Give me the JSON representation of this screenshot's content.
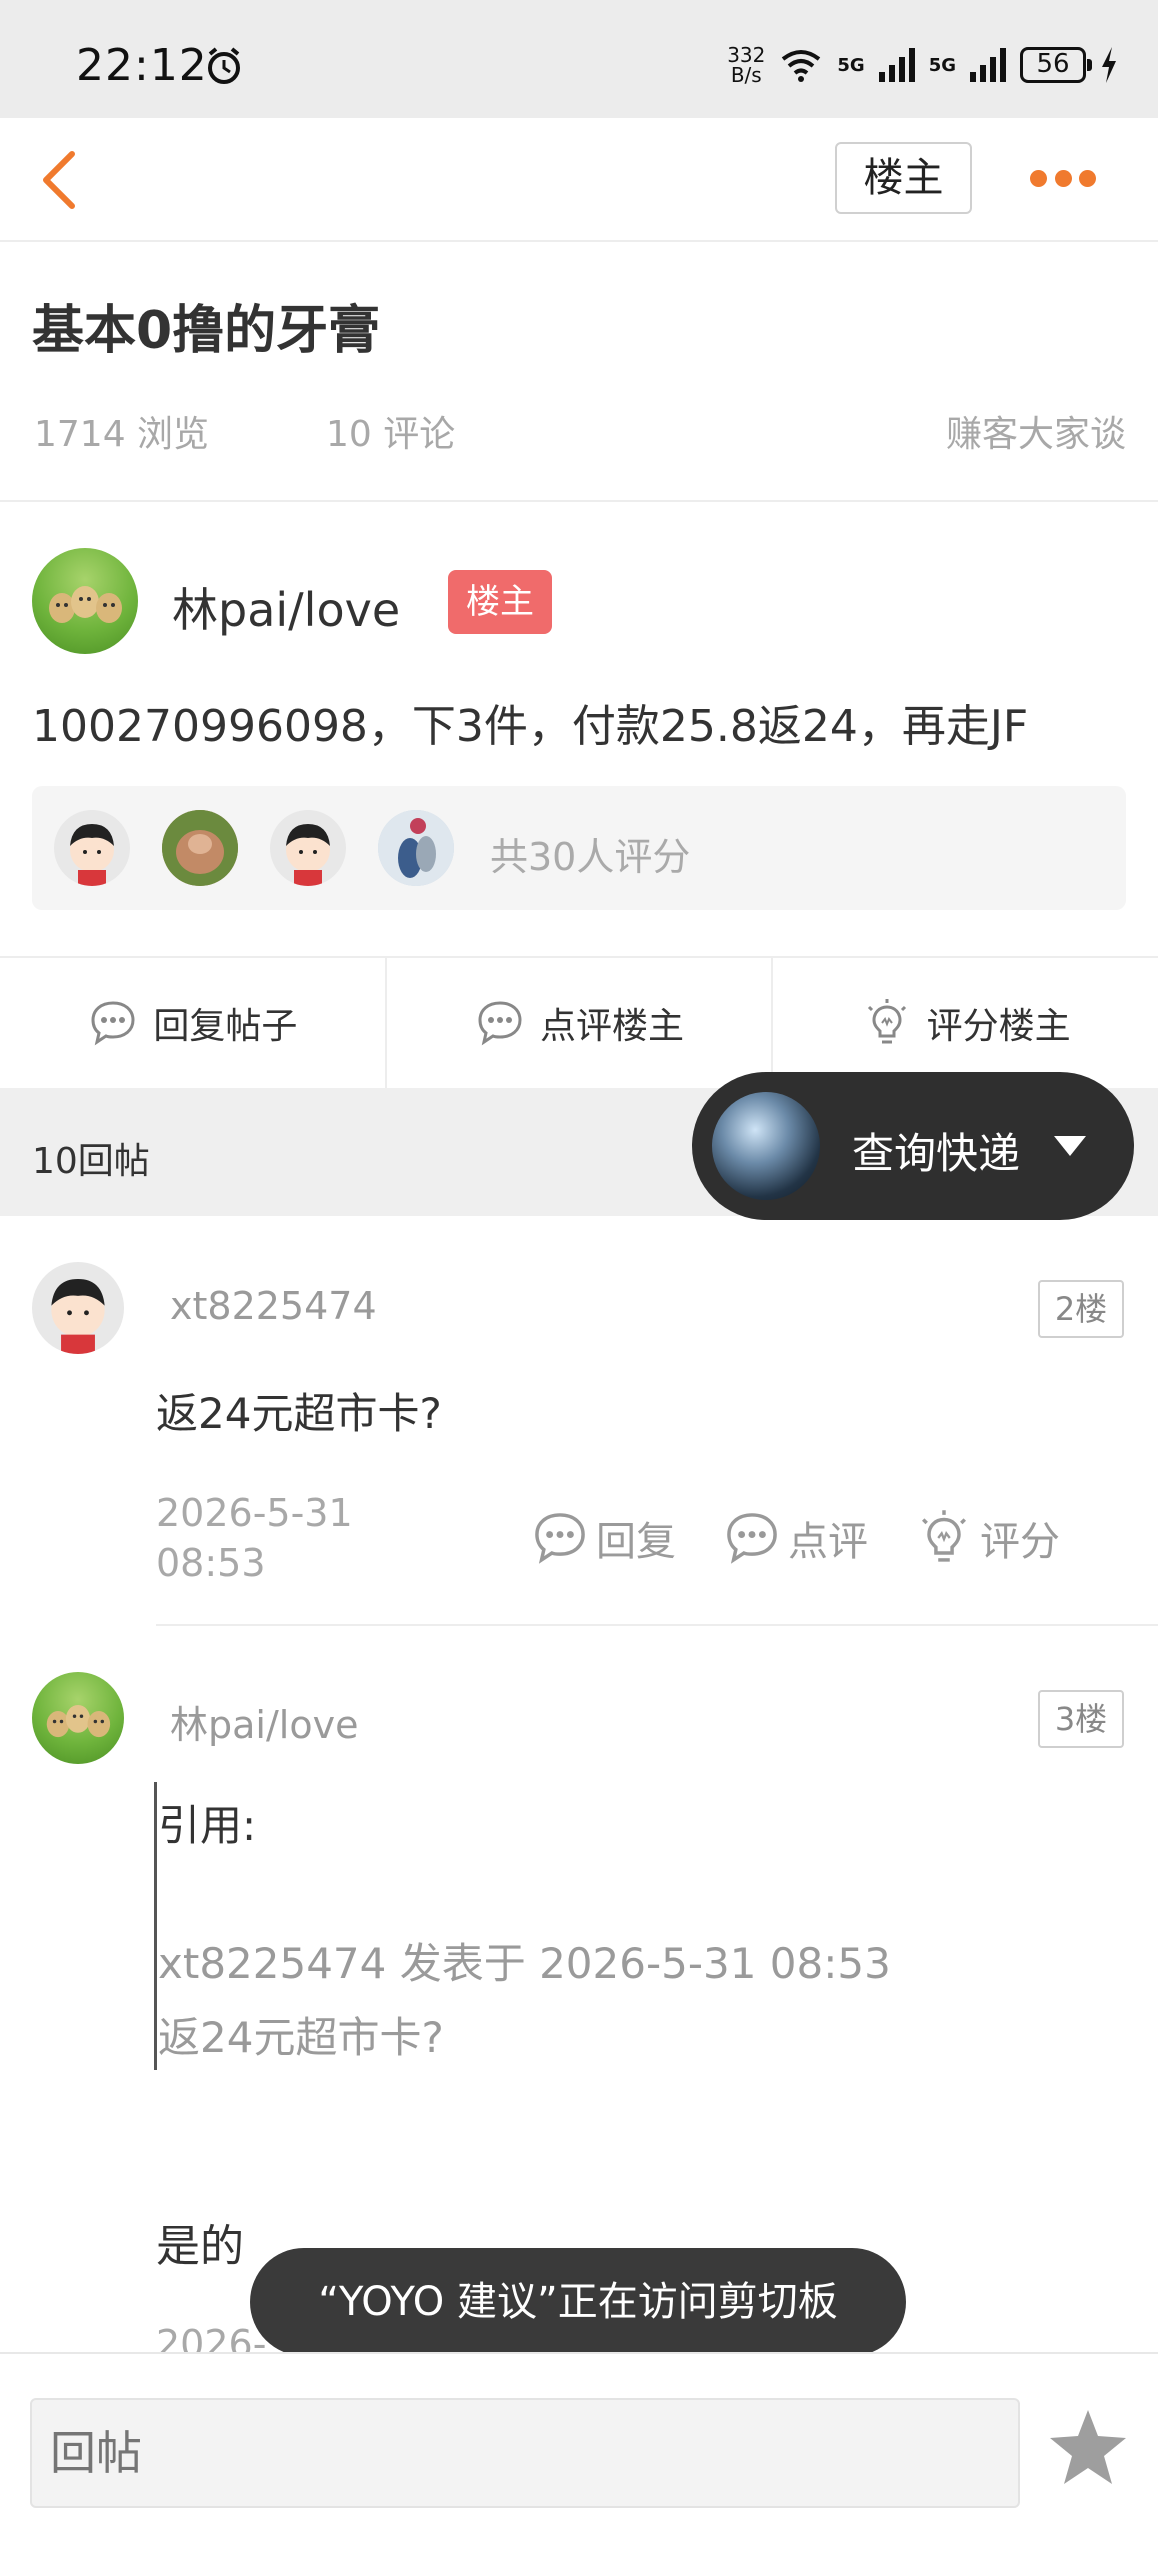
{
  "status_bar": {
    "time": "22:12",
    "speed_value": "332",
    "speed_unit": "B/s",
    "net1": "5G",
    "net2": "5G",
    "battery": "56"
  },
  "nav": {
    "op_only_label": "楼主"
  },
  "post": {
    "title": "基本0撸的牙膏",
    "views": "1714 浏览",
    "comments": "10 评论",
    "forum": "赚客大家谈"
  },
  "op": {
    "name": "林pai/love",
    "badge": "楼主",
    "content": "100270996098，下3件，付款25.8返24，再走JF",
    "raters_text": "共30人评分"
  },
  "actions": {
    "reply_post": "回复帖子",
    "comment_op": "点评楼主",
    "rate_op": "评分楼主"
  },
  "replies_header": {
    "count": "10回帖"
  },
  "express": {
    "label": "查询快递"
  },
  "replies": [
    {
      "user": "xt8225474",
      "floor": "2楼",
      "text": "返24元超市卡?",
      "date_line1": "2026-5-31",
      "date_line2": "08:53",
      "reply": "回复",
      "comment": "点评",
      "rate": "评分"
    },
    {
      "user": "林pai/love",
      "floor": "3楼",
      "quote_label": "引用:",
      "quote_meta": "xt8225474 发表于 2026-5-31 08:53",
      "quote_text": "返24元超市卡?",
      "text": "是的",
      "date_partial": "2026-"
    }
  ],
  "toast": {
    "text": "“YOYO 建议”正在访问剪切板"
  },
  "bottom": {
    "input_placeholder": "回帖"
  }
}
